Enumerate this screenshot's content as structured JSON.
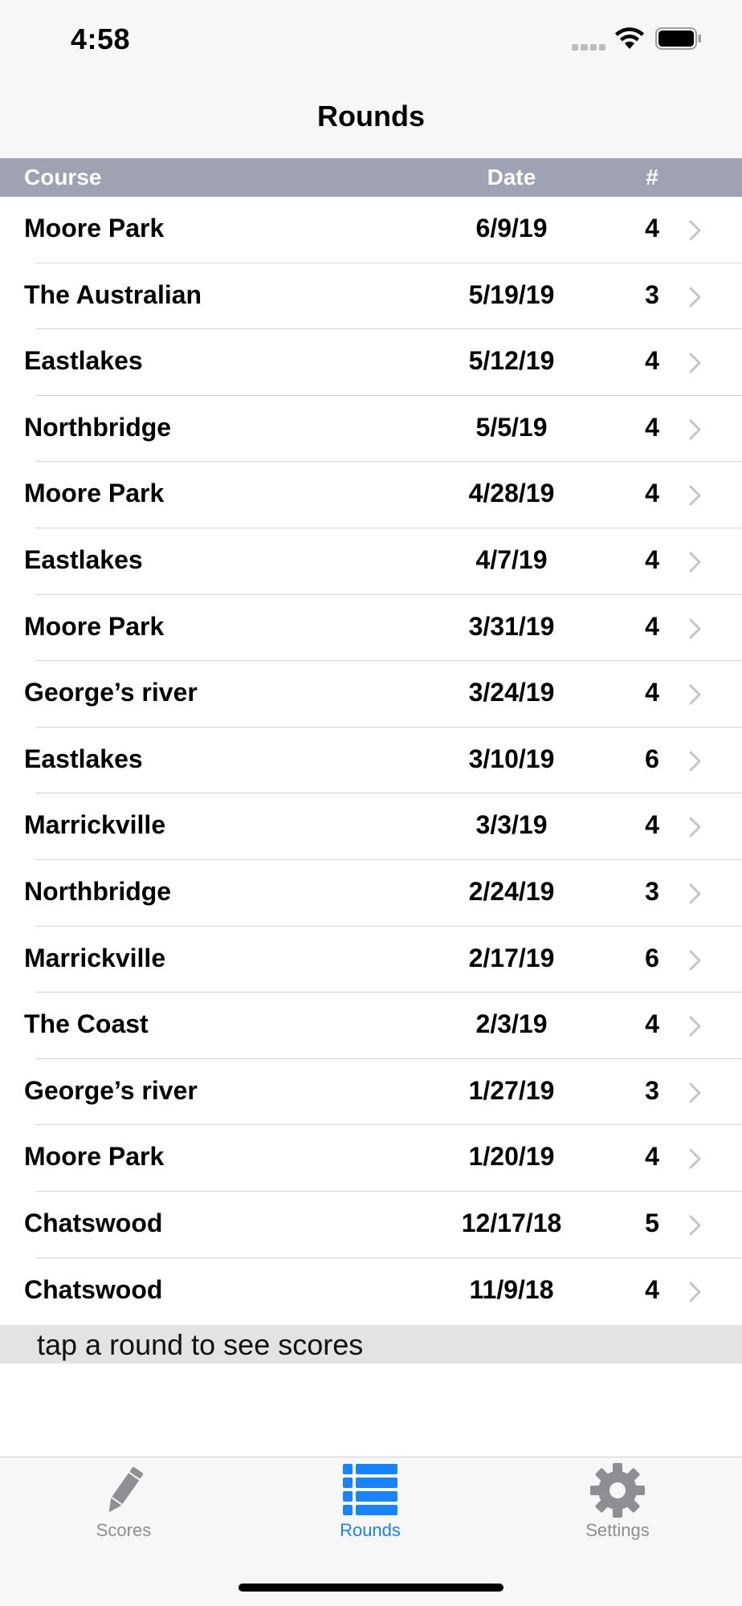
{
  "status": {
    "time": "4:58"
  },
  "nav": {
    "title": "Rounds"
  },
  "table": {
    "headers": {
      "course": "Course",
      "date": "Date",
      "count": "#"
    },
    "rows": [
      {
        "course": "Moore Park",
        "date": "6/9/19",
        "count": "4"
      },
      {
        "course": "The Australian",
        "date": "5/19/19",
        "count": "3"
      },
      {
        "course": "Eastlakes",
        "date": "5/12/19",
        "count": "4"
      },
      {
        "course": "Northbridge",
        "date": "5/5/19",
        "count": "4"
      },
      {
        "course": "Moore Park",
        "date": "4/28/19",
        "count": "4"
      },
      {
        "course": "Eastlakes",
        "date": "4/7/19",
        "count": "4"
      },
      {
        "course": "Moore Park",
        "date": "3/31/19",
        "count": "4"
      },
      {
        "course": "George’s river",
        "date": "3/24/19",
        "count": "4"
      },
      {
        "course": "Eastlakes",
        "date": "3/10/19",
        "count": "6"
      },
      {
        "course": "Marrickville",
        "date": "3/3/19",
        "count": "4"
      },
      {
        "course": "Northbridge",
        "date": "2/24/19",
        "count": "3"
      },
      {
        "course": "Marrickville",
        "date": "2/17/19",
        "count": "6"
      },
      {
        "course": "The Coast",
        "date": "2/3/19",
        "count": "4"
      },
      {
        "course": "George’s river",
        "date": "1/27/19",
        "count": "3"
      },
      {
        "course": "Moore Park",
        "date": "1/20/19",
        "count": "4"
      },
      {
        "course": "Chatswood",
        "date": "12/17/18",
        "count": "5"
      },
      {
        "course": "Chatswood",
        "date": "11/9/18",
        "count": "4"
      }
    ]
  },
  "hint": "tap a round to see scores",
  "tabs": [
    {
      "label": "Scores",
      "icon": "pencil-icon",
      "selected": false
    },
    {
      "label": "Rounds",
      "icon": "list-icon",
      "selected": true
    },
    {
      "label": "Settings",
      "icon": "gear-icon",
      "selected": false
    }
  ],
  "colors": {
    "accent": "#1a82fb",
    "header_bar": "#9fa2b3",
    "inactive_tab": "#8e8e93"
  }
}
